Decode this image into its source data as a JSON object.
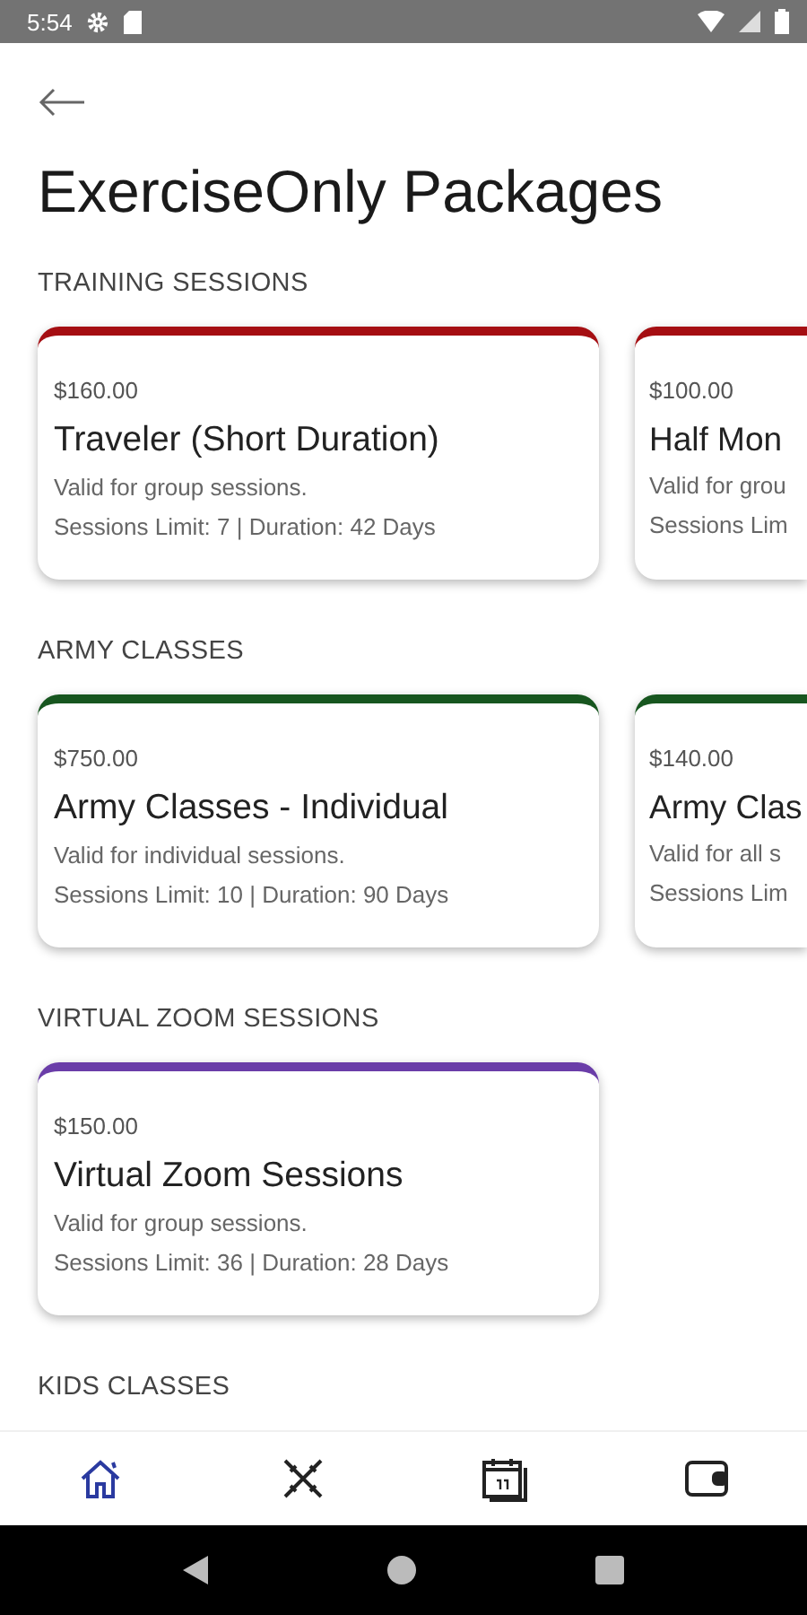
{
  "status_bar": {
    "time": "5:54"
  },
  "title": "ExerciseOnly Packages",
  "sections": [
    {
      "heading": "TRAINING SESSIONS",
      "packages": [
        {
          "price": "$160.00",
          "name": "Traveler (Short Duration)",
          "description": "Valid for group sessions.",
          "details": "Sessions Limit: 7 | Duration: 42 Days",
          "color": "#a50e12"
        },
        {
          "price": "$100.00",
          "name": "Half Mon",
          "description": "Valid for grou",
          "details": "Sessions Lim",
          "color": "#a50e12"
        }
      ]
    },
    {
      "heading": "ARMY CLASSES",
      "packages": [
        {
          "price": "$750.00",
          "name": "Army Classes - Individual",
          "description": "Valid for individual sessions.",
          "details": "Sessions Limit: 10 | Duration: 90 Days",
          "color": "#17561f"
        },
        {
          "price": "$140.00",
          "name": "Army Clas",
          "description": "Valid for all s",
          "details": "Sessions Lim",
          "color": "#17561f"
        }
      ]
    },
    {
      "heading": "VIRTUAL ZOOM SESSIONS",
      "packages": [
        {
          "price": "$150.00",
          "name": "Virtual Zoom Sessions",
          "description": "Valid for group sessions.",
          "details": "Sessions Limit: 36 | Duration: 28 Days",
          "color": "#6a3da8"
        }
      ]
    },
    {
      "heading": "KIDS CLASSES"
    }
  ],
  "bottom_nav": [
    {
      "kind": "home",
      "selected": true
    },
    {
      "kind": "swords",
      "selected": false
    },
    {
      "kind": "calendar",
      "selected": false
    },
    {
      "kind": "wallet",
      "selected": false
    }
  ]
}
